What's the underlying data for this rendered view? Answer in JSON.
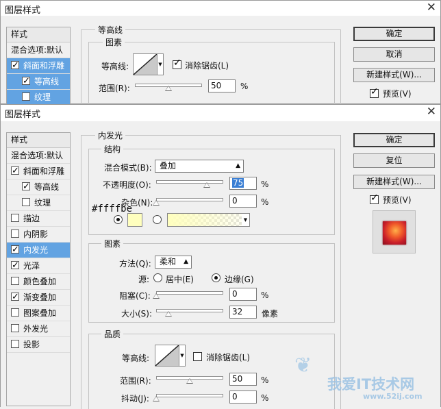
{
  "back_dialog": {
    "title": "图层样式",
    "styles_header": "样式",
    "blend_default": "混合选项:默认",
    "items": [
      {
        "label": "斜面和浮雕",
        "checked": true
      },
      {
        "label": "等高线",
        "checked": true
      },
      {
        "label": "纹理",
        "checked": false
      }
    ],
    "section_title": "等高线",
    "group_title": "图素",
    "contour_label": "等高线:",
    "antialias_label": "消除锯齿(L)",
    "range_label": "范围(R):",
    "range_value": "50",
    "percent": "%",
    "ok": "确定",
    "cancel": "取消",
    "new_style": "新建样式(W)...",
    "preview": "预览(V)"
  },
  "front_dialog": {
    "title": "图层样式",
    "styles_header": "样式",
    "blend_default": "混合选项:默认",
    "items": [
      {
        "label": "斜面和浮雕",
        "checked": true
      },
      {
        "label": "等高线",
        "checked": true
      },
      {
        "label": "纹理",
        "checked": false
      },
      {
        "label": "描边",
        "checked": false
      },
      {
        "label": "内阴影",
        "checked": false
      },
      {
        "label": "内发光",
        "checked": true
      },
      {
        "label": "光泽",
        "checked": true
      },
      {
        "label": "颜色叠加",
        "checked": false
      },
      {
        "label": "渐变叠加",
        "checked": true
      },
      {
        "label": "图案叠加",
        "checked": false
      },
      {
        "label": "外发光",
        "checked": false
      },
      {
        "label": "投影",
        "checked": false
      }
    ],
    "section_title": "内发光",
    "structure": {
      "title": "结构",
      "blend_mode_label": "混合模式(B):",
      "blend_mode_value": "叠加",
      "opacity_label": "不透明度(O):",
      "opacity_value": "75",
      "opacity_level": 0.75,
      "noise_label": "杂色(N):",
      "noise_value": "0",
      "percent": "%",
      "color_hex": "#ffffbe",
      "color_swatch": "#ffffbe"
    },
    "elements": {
      "title": "图素",
      "method_label": "方法(Q):",
      "method_value": "柔和",
      "source_label": "源:",
      "center_label": "居中(E)",
      "edge_label": "边缘(G)",
      "choke_label": "阻塞(C):",
      "choke_value": "0",
      "size_label": "大小(S):",
      "size_value": "32",
      "size_unit": "像素",
      "percent": "%"
    },
    "quality": {
      "title": "品质",
      "contour_label": "等高线:",
      "antialias_label": "消除锯齿(L)",
      "range_label": "范围(R):",
      "range_value": "50",
      "jitter_label": "抖动(J):",
      "jitter_value": "0",
      "percent": "%"
    },
    "ok": "确定",
    "reset": "复位",
    "new_style": "新建样式(W)...",
    "preview": "预览(V)"
  },
  "watermark": {
    "text": "我爱IT技术网",
    "url": "www.52ij.com"
  }
}
